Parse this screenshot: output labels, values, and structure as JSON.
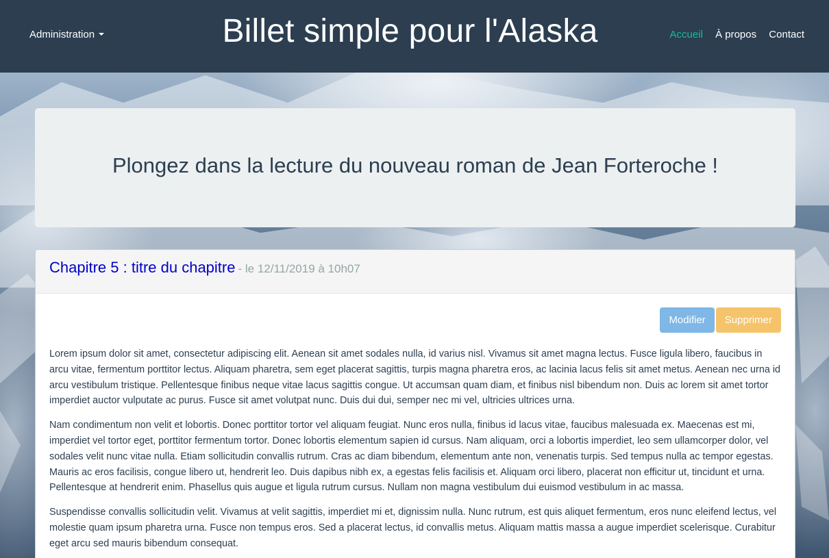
{
  "navbar": {
    "admin_label": "Administration",
    "brand": "Billet simple pour l'Alaska",
    "links": [
      {
        "label": "Accueil",
        "active": true
      },
      {
        "label": "À propos",
        "active": false
      },
      {
        "label": "Contact",
        "active": false
      }
    ]
  },
  "jumbotron": {
    "headline": "Plongez dans la lecture du nouveau roman de Jean Forteroche !"
  },
  "chapter": {
    "title": "Chapitre 5 : titre du chapitre",
    "meta": "- le 12/11/2019 à 10h07",
    "edit_label": "Modifier",
    "delete_label": "Supprimer",
    "paragraphs": [
      "Lorem ipsum dolor sit amet, consectetur adipiscing elit. Aenean sit amet sodales nulla, id varius nisl. Vivamus sit amet magna lectus. Fusce ligula libero, faucibus in arcu vitae, fermentum porttitor lectus. Aliquam pharetra, sem eget placerat sagittis, turpis magna pharetra eros, ac lacinia lacus felis sit amet metus. Aenean nec urna id arcu vestibulum tristique. Pellentesque finibus neque vitae lacus sagittis congue. Ut accumsan quam diam, et finibus nisl bibendum non. Duis ac lorem sit amet tortor imperdiet auctor vulputate ac purus. Fusce sit amet volutpat nunc. Duis dui dui, semper nec mi vel, ultricies ultrices urna.",
      "Nam condimentum non velit et lobortis. Donec porttitor tortor vel aliquam feugiat. Nunc eros nulla, finibus id lacus vitae, faucibus malesuada ex. Maecenas est mi, imperdiet vel tortor eget, porttitor fermentum tortor. Donec lobortis elementum sapien id cursus. Nam aliquam, orci a lobortis imperdiet, leo sem ullamcorper dolor, vel sodales velit nunc vitae nulla. Etiam sollicitudin convallis rutrum. Cras ac diam bibendum, elementum ante non, venenatis turpis. Sed tempus nulla ac tempor egestas. Mauris ac eros facilisis, congue libero ut, hendrerit leo. Duis dapibus nibh ex, a egestas felis facilisis et. Aliquam orci libero, placerat non efficitur ut, tincidunt et urna. Pellentesque at hendrerit enim. Phasellus quis augue et ligula rutrum cursus. Nullam non magna vestibulum dui euismod vestibulum in ac massa.",
      "Suspendisse convallis sollicitudin velit. Vivamus at velit sagittis, imperdiet mi et, dignissim nulla. Nunc rutrum, est quis aliquet fermentum, eros nunc eleifend lectus, vel molestie quam ipsum pharetra urna. Fusce non tempus eros. Sed a placerat lectus, id convallis metus. Aliquam mattis massa a augue imperdiet scelerisque. Curabitur eget arcu sed mauris bibendum consequat."
    ]
  },
  "colors": {
    "navbar_bg": "#2c3e50",
    "active_link": "#18bc9c",
    "chapter_title": "#0000c8",
    "edit_button": "#7fb7e6",
    "delete_button": "#f5c36a"
  }
}
